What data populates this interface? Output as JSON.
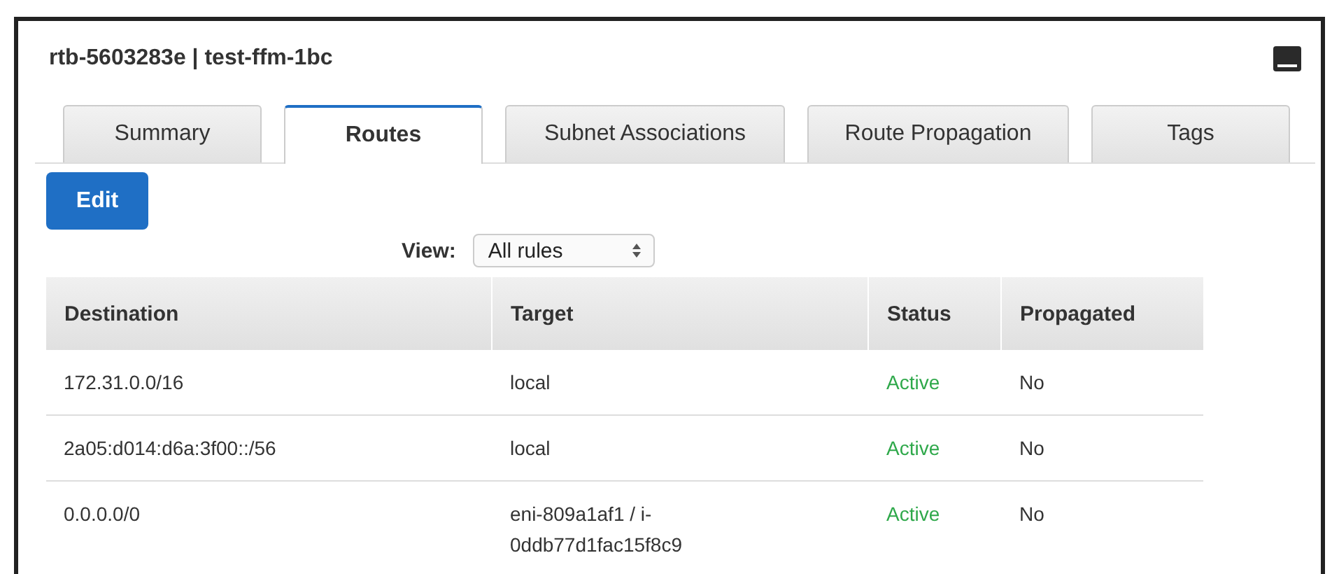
{
  "panel": {
    "title": "rtb-5603283e | test-ffm-1bc"
  },
  "tabs": [
    {
      "label": "Summary",
      "selected": false
    },
    {
      "label": "Routes",
      "selected": true
    },
    {
      "label": "Subnet Associations",
      "selected": false
    },
    {
      "label": "Route Propagation",
      "selected": false
    },
    {
      "label": "Tags",
      "selected": false
    }
  ],
  "edit_button": "Edit",
  "view": {
    "label": "View:",
    "value": "All rules"
  },
  "table": {
    "columns": [
      "Destination",
      "Target",
      "Status",
      "Propagated"
    ],
    "rows": [
      {
        "destination": "172.31.0.0/16",
        "target": "local",
        "status": "Active",
        "propagated": "No"
      },
      {
        "destination": "2a05:d014:d6a:3f00::/56",
        "target": "local",
        "status": "Active",
        "propagated": "No"
      },
      {
        "destination": "0.0.0.0/0",
        "target": "eni-809a1af1 / i-0ddb77d1fac15f8c9",
        "status": "Active",
        "propagated": "No"
      }
    ]
  }
}
